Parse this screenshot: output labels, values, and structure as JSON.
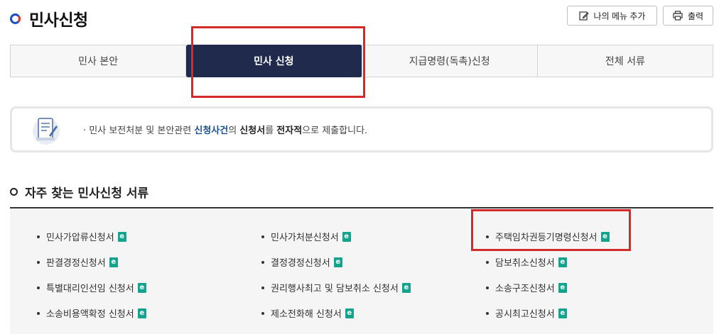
{
  "header": {
    "title": "민사신청",
    "my_menu_label": "나의 메뉴 추가",
    "print_label": "출력"
  },
  "tabs": [
    {
      "label": "민사 본안",
      "active": false
    },
    {
      "label": "민사 신청",
      "active": true
    },
    {
      "label": "지급명령(독촉)신청",
      "active": false
    },
    {
      "label": "전체 서류",
      "active": false
    }
  ],
  "notice": {
    "prefix": "· 민사 보전처분 및 본안관련 ",
    "highlight1": "신청사건",
    "mid1": "의 ",
    "highlight2": "신청서",
    "mid2": "를 ",
    "highlight3": "전자적",
    "suffix": "으로 제출합니다."
  },
  "section": {
    "title": "자주 찾는 민사신청 서류"
  },
  "forms": [
    "민사가압류신청서",
    "민사가처분신청서",
    "주택임차권등기명령신청서",
    "판결경정신청서",
    "결정경정신청서",
    "담보취소신청서",
    "특별대리인선임 신청서",
    "권리행사최고 및 담보취소 신청서",
    "소송구조신청서",
    "소송비용액확정 신청서",
    "제소전화해 신청서",
    "공시최고신청서"
  ],
  "badge_letter": "e",
  "colors": {
    "active_tab_bg": "#1f2a4d",
    "highlight_box": "#d52a2a",
    "e_badge": "#14a38d",
    "notice_blue": "#1c4f8f"
  }
}
